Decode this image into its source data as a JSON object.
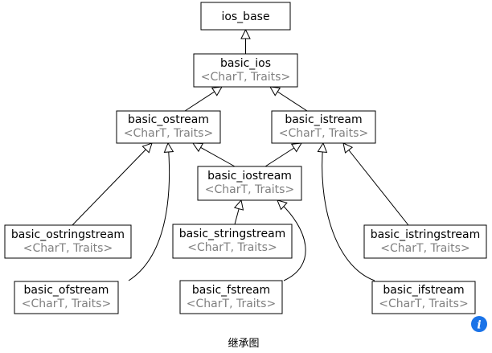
{
  "diagram": {
    "nodes": {
      "ios_base": {
        "name": "ios_base",
        "tparams": ""
      },
      "basic_ios": {
        "name": "basic_ios",
        "tparams": "<CharT, Traits>"
      },
      "basic_ostream": {
        "name": "basic_ostream",
        "tparams": "<CharT, Traits>"
      },
      "basic_istream": {
        "name": "basic_istream",
        "tparams": "<CharT, Traits>"
      },
      "basic_iostream": {
        "name": "basic_iostream",
        "tparams": "<CharT, Traits>"
      },
      "basic_ostringstream": {
        "name": "basic_ostringstream",
        "tparams": "<CharT, Traits>"
      },
      "basic_stringstream": {
        "name": "basic_stringstream",
        "tparams": "<CharT, Traits>"
      },
      "basic_istringstream": {
        "name": "basic_istringstream",
        "tparams": "<CharT, Traits>"
      },
      "basic_ofstream": {
        "name": "basic_ofstream",
        "tparams": "<CharT, Traits>"
      },
      "basic_fstream": {
        "name": "basic_fstream",
        "tparams": "<CharT, Traits>"
      },
      "basic_ifstream": {
        "name": "basic_ifstream",
        "tparams": "<CharT, Traits>"
      }
    },
    "edges": [
      {
        "from": "basic_ios",
        "to": "ios_base"
      },
      {
        "from": "basic_ostream",
        "to": "basic_ios"
      },
      {
        "from": "basic_istream",
        "to": "basic_ios"
      },
      {
        "from": "basic_iostream",
        "to": "basic_ostream"
      },
      {
        "from": "basic_iostream",
        "to": "basic_istream"
      },
      {
        "from": "basic_ostringstream",
        "to": "basic_ostream"
      },
      {
        "from": "basic_ofstream",
        "to": "basic_ostream"
      },
      {
        "from": "basic_stringstream",
        "to": "basic_iostream"
      },
      {
        "from": "basic_fstream",
        "to": "basic_iostream"
      },
      {
        "from": "basic_istringstream",
        "to": "basic_istream"
      },
      {
        "from": "basic_ifstream",
        "to": "basic_istream"
      }
    ],
    "caption": "继承图",
    "info_icon": "info-icon"
  }
}
